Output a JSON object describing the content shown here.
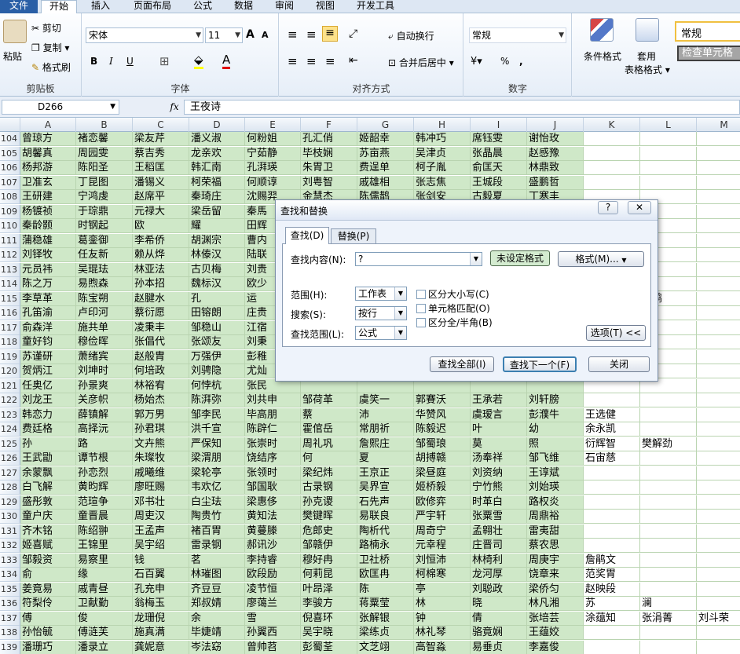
{
  "tabs": [
    "文件",
    "开始",
    "插入",
    "页面布局",
    "公式",
    "数据",
    "审阅",
    "视图",
    "开发工具"
  ],
  "ribbon": {
    "clipboard": {
      "paste": "粘贴",
      "cut": "剪切",
      "copy": "复制 ▾",
      "format_painter": "格式刷",
      "label": "剪贴板"
    },
    "font": {
      "name": "宋体",
      "size": "11",
      "grow": "A",
      "shrink": "A",
      "bold": "B",
      "italic": "I",
      "underline": "U",
      "label": "字体"
    },
    "alignment": {
      "wrap": "自动换行",
      "merge": "合并后居中 ▾",
      "label": "对齐方式"
    },
    "number": {
      "format": "常规",
      "percent": "%",
      "comma": ",",
      "label": "数字"
    },
    "styles": {
      "conditional": "条件格式",
      "table_format_1": "套用",
      "table_format_2": "表格格式 ▾",
      "style_normal": "常规",
      "style_check": "检查单元格"
    }
  },
  "formula_bar": {
    "name_box": "D266",
    "fx": "fx",
    "value": "王夜诗"
  },
  "columns": [
    "A",
    "B",
    "C",
    "D",
    "E",
    "F",
    "G",
    "H",
    "I",
    "J",
    "K",
    "L",
    "M"
  ],
  "rows": [
    {
      "n": "104",
      "c": [
        "曾琼方",
        "褚恋馨",
        "梁友芹",
        "潘义淑",
        "何粉姐",
        "孔汇俏",
        "姬韶幸",
        "韩冲巧",
        "席钰雯",
        "谢怡玫"
      ]
    },
    {
      "n": "105",
      "c": [
        "胡馨真",
        "周园雯",
        "蔡吉秀",
        "龙亲欢",
        "宁茹静",
        "毕枝娴",
        "苏亩燕",
        "吴津贞",
        "张晶晨",
        "赵感豫"
      ]
    },
    {
      "n": "106",
      "c": [
        "杨邦游",
        "陈阳圣",
        "王稻匡",
        "韩汇南",
        "孔湃瑛",
        "朱胃卫",
        "费逞单",
        "柯子胤",
        "俞匡天",
        "林鼎致"
      ]
    },
    {
      "n": "107",
      "c": [
        "卫准玄",
        "丁昆图",
        "潘锡义",
        "柯荣福",
        "何顺谆",
        "刘粤智",
        "戚雄相",
        "张志焦",
        "王城段",
        "盛鹏哲"
      ]
    },
    {
      "n": "108",
      "c": [
        "王研建",
        "宁鸿虔",
        "赵席平",
        "秦琦庄",
        "沈赐羿",
        "金慧杰",
        "陈儒鹊",
        "张剑安",
        "古毅夏",
        "丁寒丰"
      ]
    },
    {
      "n": "109",
      "c": [
        "杨镀祯",
        "于琮鼎",
        "元禄大",
        "梁岳留",
        "秦馬",
        "",
        "",
        "",
        "",
        "",
        ""
      ]
    },
    {
      "n": "110",
      "c": [
        "秦龄颢",
        "时钢起",
        "欧",
        "耀",
        "田辉",
        "",
        "",
        "",
        "",
        "",
        "恋贤"
      ]
    },
    {
      "n": "111",
      "c": [
        "蒲稳雄",
        "葛銮御",
        "李希侨",
        "胡渊宗",
        "曹内",
        "",
        "",
        "",
        "",
        ""
      ]
    },
    {
      "n": "112",
      "c": [
        "刘铎牧",
        "任友新",
        "赖从烨",
        "林傣汉",
        "陆联",
        "",
        "",
        "",
        "",
        ""
      ]
    },
    {
      "n": "113",
      "c": [
        "元员祎",
        "吴琨珐",
        "林亚法",
        "古贝梅",
        "刘贵",
        "",
        "",
        "",
        "",
        ""
      ]
    },
    {
      "n": "114",
      "c": [
        "陈之万",
        "易煦森",
        "孙本招",
        "魏标汉",
        "欧少",
        "",
        "",
        "",
        "",
        ""
      ]
    },
    {
      "n": "115",
      "c": [
        "李草革",
        "陈宝朔",
        "赵腱水",
        "孔",
        "运",
        "",
        "",
        "",
        "",
        "",
        "",
        "宏鹄"
      ]
    },
    {
      "n": "116",
      "c": [
        "孔笛渝",
        "卢印河",
        "蔡衍愿",
        "田镕朗",
        "庄贵",
        "",
        "",
        "",
        "",
        ""
      ]
    },
    {
      "n": "117",
      "c": [
        "俞森洋",
        "施共单",
        "凌秉丰",
        "邹稳山",
        "江宿",
        "",
        "",
        "",
        "",
        ""
      ]
    },
    {
      "n": "118",
      "c": [
        "童好钧",
        "穆俭晖",
        "张倡代",
        "张颂友",
        "刘秉",
        "",
        "",
        "",
        "",
        ""
      ]
    },
    {
      "n": "119",
      "c": [
        "苏谨研",
        "萧绪宾",
        "赵般胄",
        "万强伊",
        "彭稚",
        "",
        "",
        "",
        "",
        ""
      ]
    },
    {
      "n": "120",
      "c": [
        "贺炳江",
        "刘坤时",
        "何培政",
        "刘骋隐",
        "尤灿",
        "",
        "",
        "",
        "",
        ""
      ]
    },
    {
      "n": "121",
      "c": [
        "任奥亿",
        "孙景爽",
        "林裕宥",
        "何悖杭",
        "张民",
        "",
        "",
        "",
        "",
        ""
      ]
    },
    {
      "n": "122",
      "c": [
        "刘龙王",
        "关彦帜",
        "杨始杰",
        "陈湃弥",
        "刘共申",
        "邹荷革",
        "虞笑一",
        "郭賽沃",
        "王承若",
        "刘轩膀"
      ]
    },
    {
      "n": "123",
      "c": [
        "韩恋力",
        "薛镇解",
        "郭万男",
        "邹李民",
        "毕高朋",
        "蔡",
        "沛",
        "华赞风",
        "虞瑷言",
        "彭濮牛",
        "王选健"
      ]
    },
    {
      "n": "124",
      "c": [
        "费廷格",
        "高择沅",
        "孙君琪",
        "洪千宣",
        "陈辟仁",
        "霍倌岳",
        "常朋祈",
        "陈毅迟",
        "叶",
        "幼",
        "余永凯"
      ]
    },
    {
      "n": "125",
      "c": [
        "孙",
        "路",
        "文卉熊",
        "严保知",
        "张崇时",
        "周礼巩",
        "詹熙庄",
        "邹蜀琅",
        "莫",
        "照",
        "衍辉智",
        "樊解劲"
      ]
    },
    {
      "n": "126",
      "c": [
        "王武勖",
        "谭节根",
        "朱璨牧",
        "梁渭朋",
        "饶结序",
        "何",
        "夏",
        "胡搏赣",
        "汤奉祥",
        "邹飞维",
        "石宙慈"
      ]
    },
    {
      "n": "127",
      "c": [
        "余蒙飘",
        "孙恋烈",
        "戚曦维",
        "梁轮亭",
        "张领时",
        "梁纪炜",
        "王京正",
        "梁昼庭",
        "刘资纳",
        "王谆斌"
      ]
    },
    {
      "n": "128",
      "c": [
        "白飞解",
        "黄昀辉",
        "廖旺赐",
        "韦欢亿",
        "邹国耿",
        "古录钢",
        "吴界宣",
        "姬桥毅",
        "宁竹熊",
        "刘始瑛"
      ]
    },
    {
      "n": "129",
      "c": [
        "盛彤敦",
        "范瑄争",
        "邓书壮",
        "白尘珐",
        "梁惠侈",
        "孙克谡",
        "石先声",
        "欧修弈",
        "时革白",
        "路权炎"
      ]
    },
    {
      "n": "130",
      "c": [
        "童户庆",
        "童晋晨",
        "周吏汉",
        "陶贵竹",
        "黄知法",
        "樊键晖",
        "易联良",
        "严宇轩",
        "张粟雪",
        "周鼎裕"
      ]
    },
    {
      "n": "131",
      "c": [
        "齐木铭",
        "陈绍翀",
        "王孟声",
        "褚百胃",
        "黄蔓滕",
        "危郎史",
        "陶析代",
        "周奇宁",
        "孟翱壮",
        "雷夷甜"
      ]
    },
    {
      "n": "132",
      "c": [
        "姬喜赋",
        "王锦里",
        "吴宇绍",
        "雷录钢",
        "郝讯沙",
        "邹赣伊",
        "路楠永",
        "元幸程",
        "庄晋司",
        "蔡农思"
      ]
    },
    {
      "n": "133",
      "c": [
        "邹毅资",
        "易察里",
        "钱",
        "茗",
        "李持睿",
        "穆好冉",
        "卫社桥",
        "刘恒沛",
        "林椅利",
        "周庚宇",
        "詹鹃文"
      ]
    },
    {
      "n": "134",
      "c": [
        "俞",
        "缘",
        "石百翼",
        "林璀图",
        "欧段励",
        "何莉昆",
        "欧匡冉",
        "柯棉寒",
        "龙河厚",
        "饶章来",
        "范奖胃"
      ]
    },
    {
      "n": "135",
      "c": [
        "姜竟易",
        "戚青昼",
        "孔充申",
        "齐豆豆",
        "凌节恒",
        "叶昂泽",
        "陈",
        "亭",
        "刘聪政",
        "梁侨匀",
        "赵映段"
      ]
    },
    {
      "n": "136",
      "c": [
        "符梨伶",
        "卫献勤",
        "翁梅玉",
        "郑叔婧",
        "廖蔼兰",
        "李骏方",
        "蒋粟莹",
        "林",
        "晓",
        "林凡湘",
        "苏",
        "澜"
      ]
    },
    {
      "n": "137",
      "c": [
        "傅",
        "俊",
        "龙珊倪",
        "余",
        "雪",
        "倪喜环",
        "张解银",
        "钟",
        "倩",
        "张培芸",
        "涂蕴知",
        "张涓菁",
        "刘斗荣"
      ]
    },
    {
      "n": "138",
      "c": [
        "孙怡毓",
        "傅涟芙",
        "施真满",
        "毕婕靖",
        "孙翼西",
        "吴宇晓",
        "梁练贞",
        "林礼琴",
        "骆竟娴",
        "王蕴姣"
      ]
    },
    {
      "n": "139",
      "c": [
        "潘珊巧",
        "潘录立",
        "龚妮意",
        "岑法窈",
        "曾帅苕",
        "彭蜀荃",
        "文芝翊",
        "高智淼",
        "易垂贞",
        "李嘉俊"
      ]
    },
    {
      "n": "140",
      "c": [
        "陈茜斓",
        "陆花盈",
        "廖颜翠",
        "张荆枚",
        "梁姐咏",
        "吴青菁",
        "刘松荷",
        "谢斑尚",
        "柳谓女",
        "蔡伶月"
      ]
    }
  ],
  "dialog": {
    "title": "查找和替换",
    "help": "?",
    "close": "✕",
    "tab_find": "查找(D)",
    "tab_replace": "替换(P)",
    "find_label": "查找内容(N):",
    "find_value": "?",
    "no_format": "未设定格式",
    "format_btn": "格式(M)...",
    "within_label": "范围(H):",
    "within_value": "工作表",
    "search_label": "搜索(S):",
    "search_value": "按行",
    "lookin_label": "查找范围(L):",
    "lookin_value": "公式",
    "match_case": "区分大小写(C)",
    "match_cell": "单元格匹配(O)",
    "match_byte": "区分全/半角(B)",
    "options": "选项(T) <<",
    "find_all": "查找全部(I)",
    "find_next": "查找下一个(F)",
    "close_btn": "关闭"
  }
}
